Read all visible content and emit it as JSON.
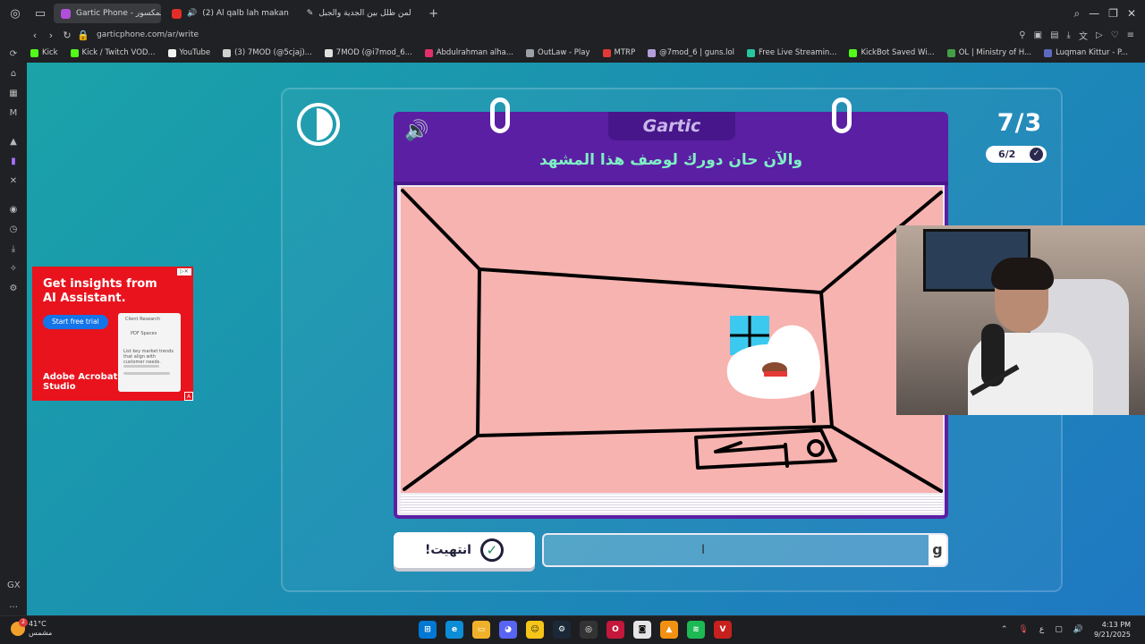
{
  "browser": {
    "tabs": [
      {
        "label": "Gartic Phone - ت المكسور",
        "active": true,
        "color": "#b04fd8"
      },
      {
        "label": "(2) Al qalb lah makan",
        "active": false,
        "color": "#e52d27"
      },
      {
        "label": "لمن ظلل بين الجدية والجبل",
        "active": false,
        "color": "#d0d0d0"
      }
    ],
    "url": "garticphone.com/ar/write",
    "bookmarks": [
      {
        "label": "Kick",
        "color": "#53fc18"
      },
      {
        "label": "Kick / Twitch VOD...",
        "color": "#53fc18"
      },
      {
        "label": "YouTube",
        "color": "#f1f1f1"
      },
      {
        "label": "(3) 7MOD (@5cjaj)...",
        "color": "#d0d0d0"
      },
      {
        "label": "7MOD (@i7mod_6...",
        "color": "#e0e0e0"
      },
      {
        "label": "Abdulrahman alha...",
        "color": "#e1306c"
      },
      {
        "label": "OutLaw - Play",
        "color": "#9aa0a6"
      },
      {
        "label": "MTRP",
        "color": "#e53935"
      },
      {
        "label": "@7mod_6 | guns.lol",
        "color": "#b39ddb"
      },
      {
        "label": "Free Live Streamin...",
        "color": "#26c6a0"
      },
      {
        "label": "KickBot Saved Wi...",
        "color": "#53fc18"
      },
      {
        "label": "OL | Ministry of H...",
        "color": "#43a047"
      },
      {
        "label": "Luqman Kittur - P...",
        "color": "#5c6bc0"
      }
    ]
  },
  "game": {
    "logo": "Gartic",
    "prompt": "والآن حان دورك لوصف هذا المشهد",
    "round": "7/3",
    "progress": "6/2",
    "done_label": "انتهيت!",
    "answer_value": "",
    "answer_char": "g"
  },
  "ad": {
    "headline": "Get insights from AI Assistant.",
    "cta": "Start free trial",
    "card_title": "Client Research",
    "card_chip": "PDF Spaces",
    "card_text": "List key market trends that align with customer needs.",
    "brand": "Adobe Acrobat Studio"
  },
  "taskbar": {
    "temp": "41°C",
    "weather_label": "مشمس",
    "weather_badge": "2",
    "time": "4:13 PM",
    "date": "9/21/2025",
    "lang": "ع"
  }
}
